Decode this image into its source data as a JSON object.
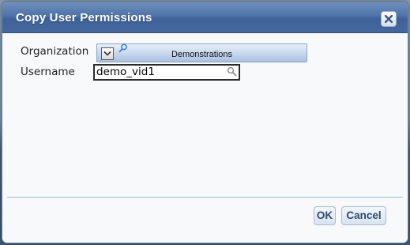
{
  "dialog": {
    "title": "Copy User Permissions",
    "close_icon": "close-icon"
  },
  "form": {
    "organization_label": "Organization",
    "organization_value": "Demonstrations",
    "organization_icons": [
      "chevron-down-icon",
      "search-icon"
    ],
    "username_label": "Username",
    "username_value": "demo_vid1",
    "username_icon": "search-icon"
  },
  "buttons": {
    "ok_label": "OK",
    "cancel_label": "Cancel"
  },
  "colors": {
    "titlebar": "#4e73a7",
    "button_text": "#304a6c",
    "separator": "#9fc7cc"
  }
}
